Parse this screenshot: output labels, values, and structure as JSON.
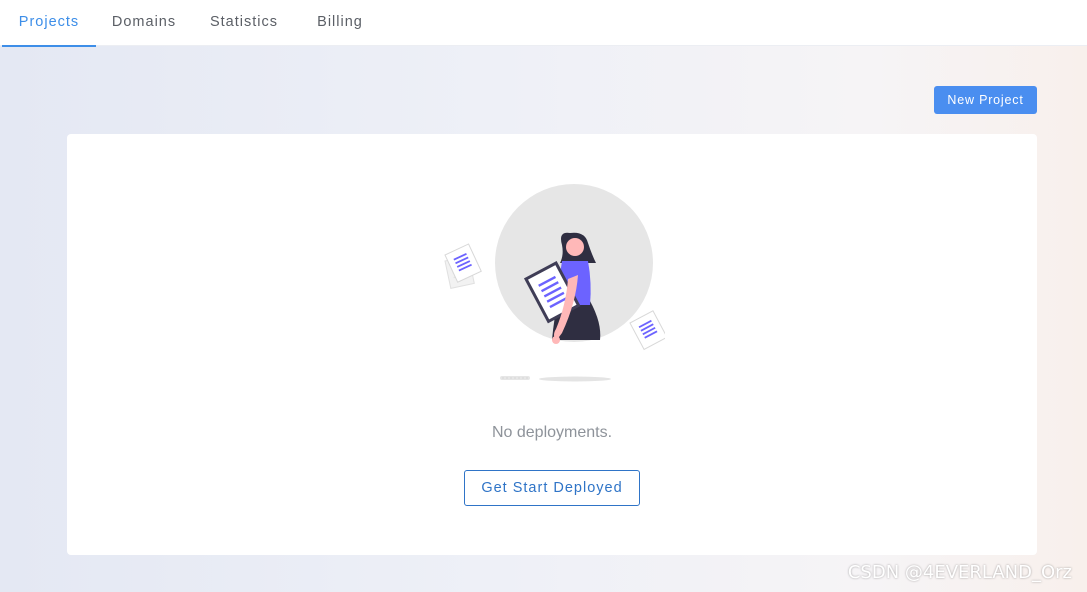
{
  "nav": {
    "tabs": [
      {
        "label": "Projects",
        "active": true
      },
      {
        "label": "Domains",
        "active": false
      },
      {
        "label": "Statistics",
        "active": false
      },
      {
        "label": "Billing",
        "active": false
      }
    ]
  },
  "toolbar": {
    "new_project_label": "New Project"
  },
  "empty_state": {
    "illustration": "woman-holding-document-illustration",
    "message": "No deployments.",
    "cta_label": "Get Start Deployed"
  },
  "watermark": "CSDN @4EVERLAND_Orz",
  "colors": {
    "accent": "#3d8ee8",
    "primary_button": "#4a8ef0",
    "cta_border": "#2f74c7",
    "illustration_purple": "#6c63ff"
  }
}
